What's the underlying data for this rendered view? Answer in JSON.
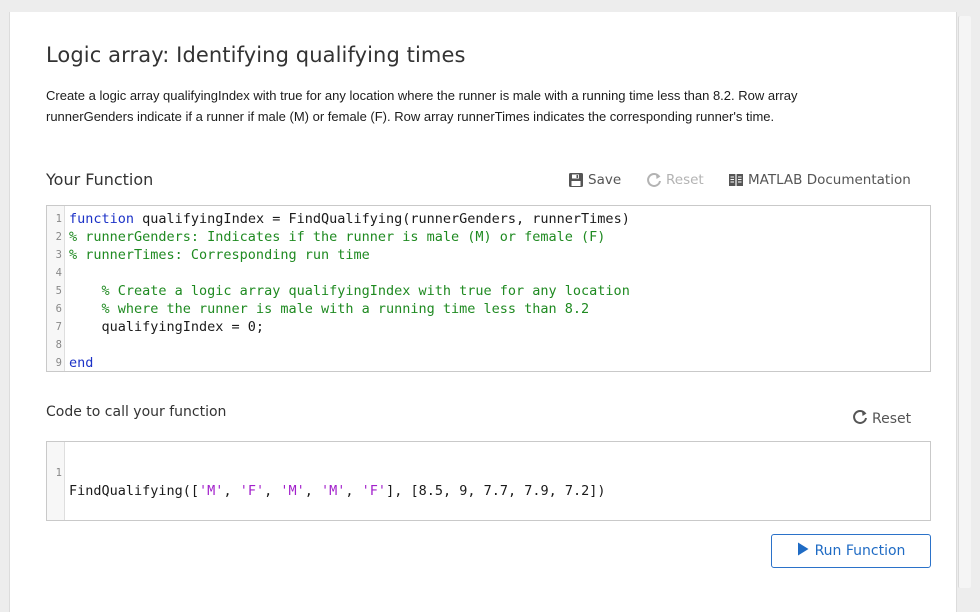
{
  "page": {
    "title": "Logic array: Identifying qualifying times",
    "description_lines": [
      "Create a logic array qualifyingIndex with true for any location where the runner is male with a running time less than 8.2. Row array",
      "runnerGenders indicate if a runner if male (M) or female (F). Row array runnerTimes indicates the corresponding runner's time."
    ]
  },
  "function_section": {
    "heading": "Your Function",
    "toolbar": {
      "save_label": "Save",
      "reset_label": "Reset",
      "doc_label": "MATLAB Documentation"
    },
    "lines": [
      {
        "n": "1",
        "kw": "function",
        "code": " qualifyingIndex = FindQualifying(runnerGenders, runnerTimes)",
        "comment": ""
      },
      {
        "n": "2",
        "kw": "",
        "code": "",
        "comment": "% runnerGenders: Indicates if the runner is male (M) or female (F)"
      },
      {
        "n": "3",
        "kw": "",
        "code": "",
        "comment": "% runnerTimes: Corresponding run time"
      },
      {
        "n": "4",
        "kw": "",
        "code": "",
        "comment": ""
      },
      {
        "n": "5",
        "kw": "",
        "code": "    ",
        "comment": "% Create a logic array qualifyingIndex with true for any location"
      },
      {
        "n": "6",
        "kw": "",
        "code": "    ",
        "comment": "% where the runner is male with a running time less than 8.2"
      },
      {
        "n": "7",
        "kw": "",
        "code": "    qualifyingIndex = 0;",
        "comment": ""
      },
      {
        "n": "8",
        "kw": "",
        "code": "",
        "comment": ""
      },
      {
        "n": "9",
        "kw": "end",
        "code": "",
        "comment": ""
      }
    ]
  },
  "call_section": {
    "heading": "Code to call your function",
    "reset_label": "Reset",
    "line_number": "1",
    "tokens": [
      {
        "t": "FindQualifying([",
        "c": "plain"
      },
      {
        "t": "'M'",
        "c": "str"
      },
      {
        "t": ", ",
        "c": "plain"
      },
      {
        "t": "'F'",
        "c": "str"
      },
      {
        "t": ", ",
        "c": "plain"
      },
      {
        "t": "'M'",
        "c": "str"
      },
      {
        "t": ", ",
        "c": "plain"
      },
      {
        "t": "'M'",
        "c": "str"
      },
      {
        "t": ", ",
        "c": "plain"
      },
      {
        "t": "'F'",
        "c": "str"
      },
      {
        "t": "], [8.5, 9, 7.7, 7.9, 7.2])",
        "c": "plain"
      }
    ]
  },
  "run_button": {
    "label": "Run Function"
  },
  "colors": {
    "keyword": "#1c32c7",
    "comment": "#1f8a21",
    "string": "#a21fcb",
    "accent": "#1f6bc4"
  }
}
